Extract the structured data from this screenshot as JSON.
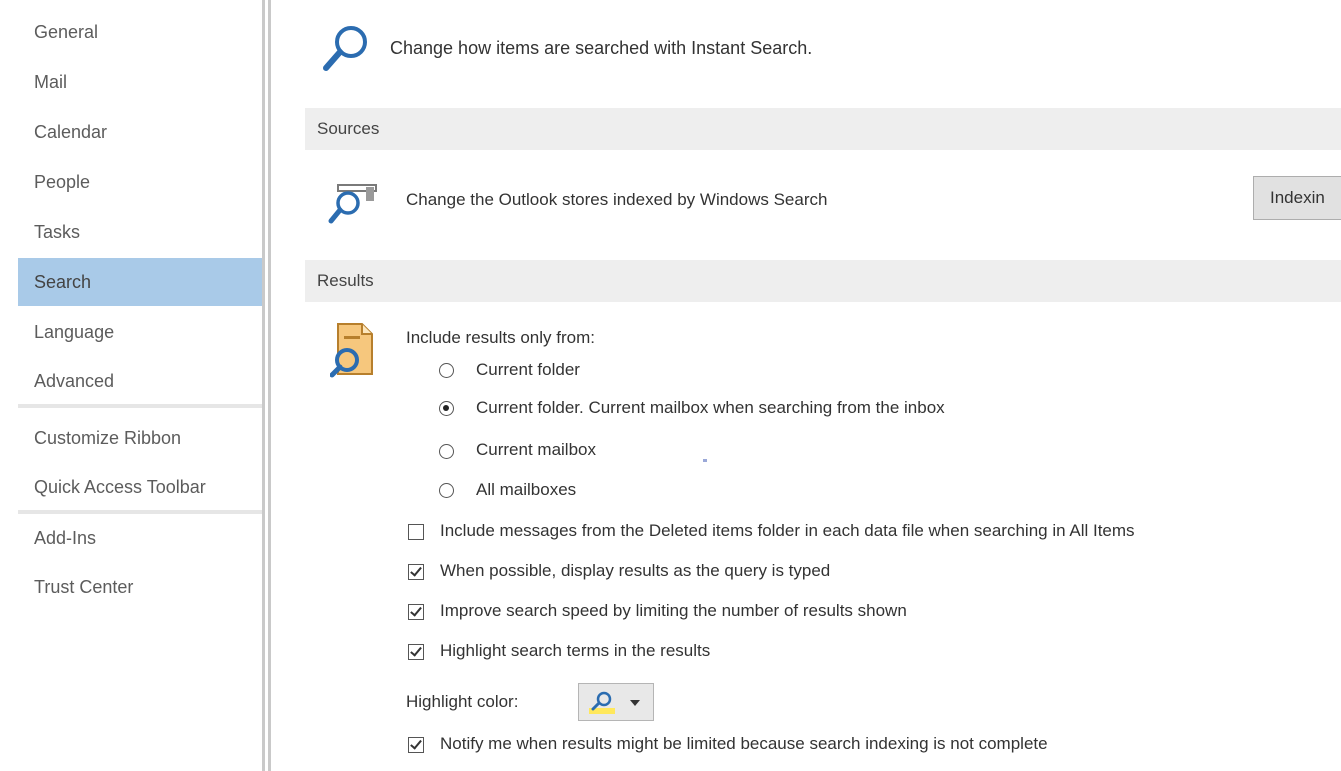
{
  "sidebar": {
    "items": [
      {
        "label": "General"
      },
      {
        "label": "Mail"
      },
      {
        "label": "Calendar"
      },
      {
        "label": "People"
      },
      {
        "label": "Tasks"
      },
      {
        "label": "Search",
        "selected": true
      },
      {
        "label": "Language"
      },
      {
        "label": "Advanced"
      },
      {
        "label": "Customize Ribbon"
      },
      {
        "label": "Quick Access Toolbar"
      },
      {
        "label": "Add-Ins"
      },
      {
        "label": "Trust Center"
      }
    ],
    "selected_color": "#a9cae8"
  },
  "main": {
    "intro_text": "Change how items are searched with Instant Search.",
    "sources": {
      "header": "Sources",
      "description": "Change the Outlook stores indexed by Windows Search",
      "button_label": "Indexin"
    },
    "results": {
      "header": "Results",
      "include_label": "Include results only from:",
      "radios": [
        {
          "label": "Current folder",
          "checked": false
        },
        {
          "label": "Current folder. Current mailbox when searching from the inbox",
          "checked": true
        },
        {
          "label": "Current mailbox",
          "checked": false
        },
        {
          "label": "All mailboxes",
          "checked": false
        }
      ],
      "checkboxes": [
        {
          "label": "Include messages from the Deleted items folder in each data file when searching in All Items",
          "checked": false
        },
        {
          "label": "When possible, display results as the query is typed",
          "checked": true
        },
        {
          "label": "Improve search speed by limiting the number of results shown",
          "checked": true
        },
        {
          "label": "Highlight search terms in the results",
          "checked": true
        }
      ],
      "highlight_color_label": "Highlight color:",
      "highlight_color_value": "#ffe85c",
      "notify_checkbox": {
        "label": "Notify me when results might be limited because search indexing is not complete",
        "checked": true
      }
    },
    "icons": {
      "intro": "search-magnifier-icon",
      "sources": "indexing-stores-icon",
      "results": "search-folder-icon",
      "color_picker": "highlight-search-icon",
      "dropdown": "dropdown-arrow-icon"
    },
    "accent_color": "#2b6cb0"
  }
}
